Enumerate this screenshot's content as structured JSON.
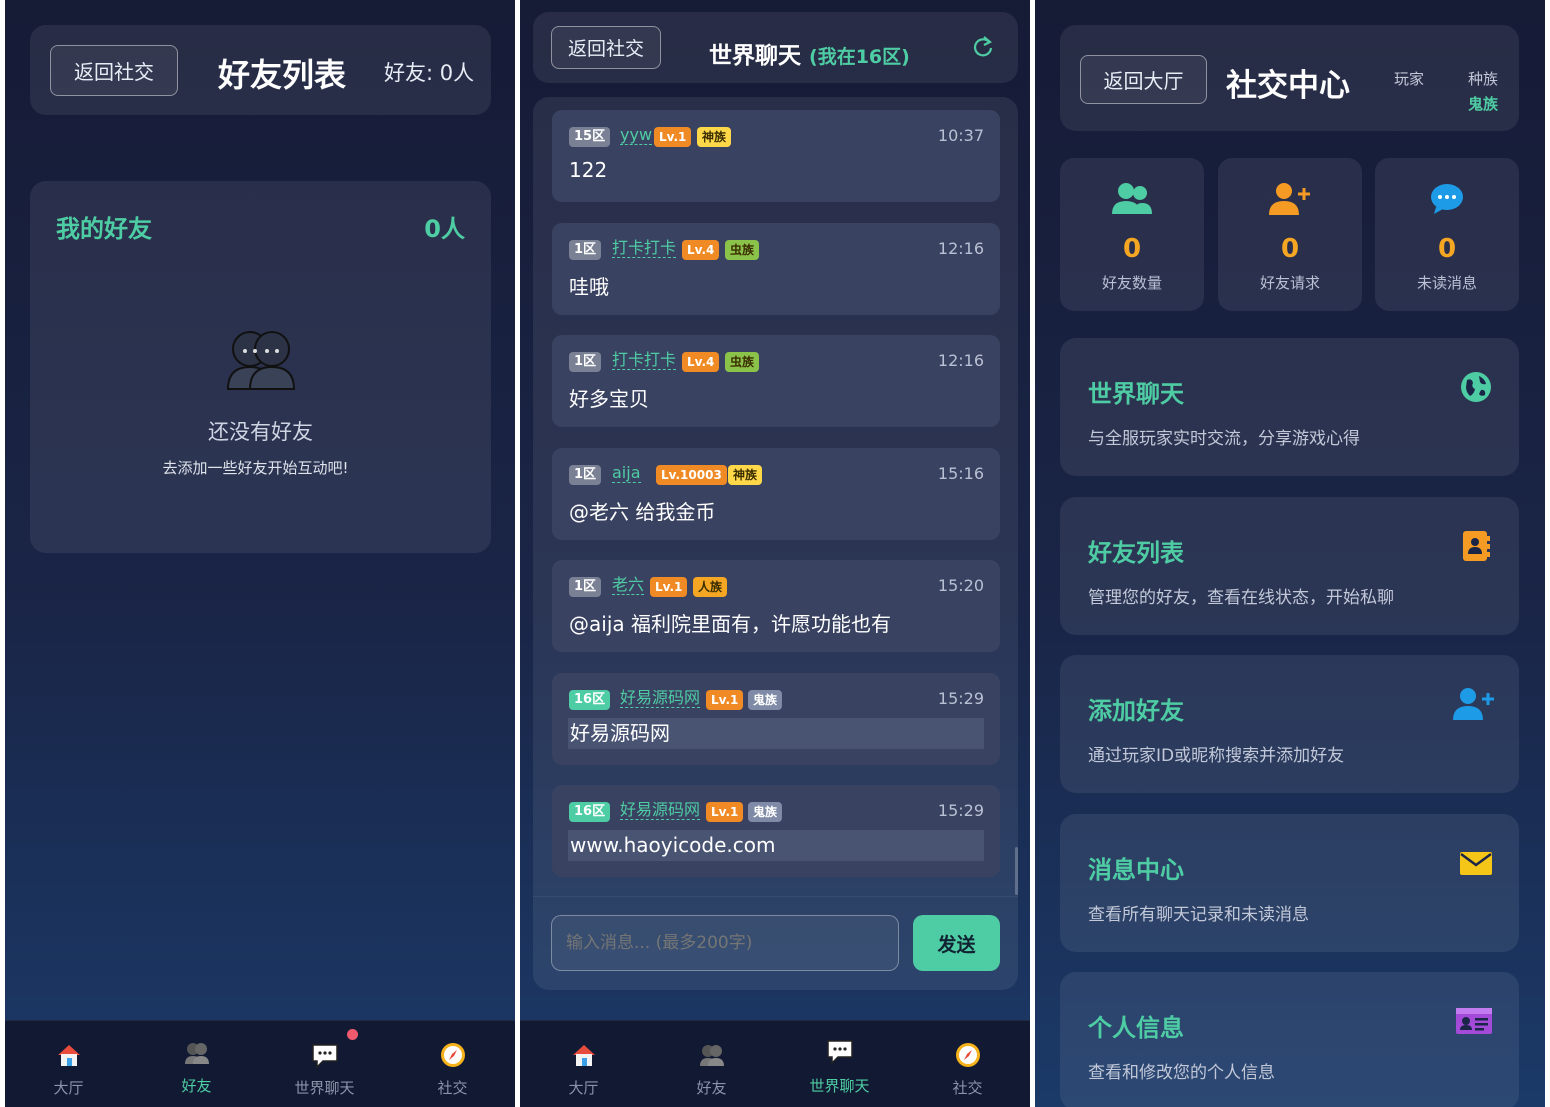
{
  "friends_screen": {
    "back_label": "返回社交",
    "title": "好友列表",
    "count_label": "好友: 0人",
    "section_title": "我的好友",
    "section_count": "0人",
    "empty_title": "还没有好友",
    "empty_hint": "去添加一些好友开始互动吧!"
  },
  "chat_screen": {
    "back_label": "返回社交",
    "title": "世界聊天",
    "zone_note": "(我在16区)",
    "refresh_icon": "refresh-icon",
    "messages": [
      {
        "zone": "15区",
        "name": "yyw",
        "level": "Lv.1",
        "race": "神族",
        "race_color": "#ffd84a",
        "time": "10:37",
        "text": "122",
        "mine": false
      },
      {
        "zone": "1区",
        "name": "打卡打卡",
        "level": "Lv.4",
        "race": "虫族",
        "race_color": "#8bc34a",
        "time": "12:16",
        "text": "哇哦",
        "mine": false
      },
      {
        "zone": "1区",
        "name": "打卡打卡",
        "level": "Lv.4",
        "race": "虫族",
        "race_color": "#8bc34a",
        "time": "12:16",
        "text": "好多宝贝",
        "mine": false
      },
      {
        "zone": "1区",
        "name": "aija",
        "level": "Lv.10003",
        "race": "神族",
        "race_color": "#ffd84a",
        "time": "15:16",
        "text": "@老六 给我金币",
        "mine": false
      },
      {
        "zone": "1区",
        "name": "老六",
        "level": "Lv.1",
        "race": "人族",
        "race_color": "#f5a623",
        "time": "15:20",
        "text": "@aija 福利院里面有，许愿功能也有",
        "mine": false
      },
      {
        "zone": "16区",
        "name": "好易源码网",
        "level": "Lv.1",
        "race": "鬼族",
        "race_color": "#7f8aa6",
        "time": "15:29",
        "text": "好易源码网",
        "mine": true
      },
      {
        "zone": "16区",
        "name": "好易源码网",
        "level": "Lv.1",
        "race": "鬼族",
        "race_color": "#7f8aa6",
        "time": "15:29",
        "text": "www.haoyicode.com",
        "mine": true
      }
    ],
    "input_placeholder": "输入消息... (最多200字)",
    "send_label": "发送"
  },
  "social_screen": {
    "back_label": "返回大厅",
    "title": "社交中心",
    "player_label": "玩家",
    "race_label": "种族",
    "race_value": "鬼族",
    "stats": [
      {
        "icon": "users-icon",
        "value": "0",
        "label": "好友数量"
      },
      {
        "icon": "user-plus-icon",
        "value": "0",
        "label": "好友请求"
      },
      {
        "icon": "chat-bubble-icon",
        "value": "0",
        "label": "未读消息"
      }
    ],
    "features": [
      {
        "icon": "globe-icon",
        "title": "世界聊天",
        "desc": "与全服玩家实时交流，分享游戏心得"
      },
      {
        "icon": "address-book-icon",
        "title": "好友列表",
        "desc": "管理您的好友，查看在线状态，开始私聊"
      },
      {
        "icon": "user-plus-icon",
        "title": "添加好友",
        "desc": "通过玩家ID或昵称搜索并添加好友"
      },
      {
        "icon": "envelope-icon",
        "title": "消息中心",
        "desc": "查看所有聊天记录和未读消息"
      },
      {
        "icon": "id-card-icon",
        "title": "个人信息",
        "desc": "查看和修改您的个人信息"
      }
    ]
  },
  "bottom_nav": {
    "items": [
      {
        "icon": "home-icon",
        "label": "大厅"
      },
      {
        "icon": "friends-icon",
        "label": "好友"
      },
      {
        "icon": "chat-icon",
        "label": "世界聊天"
      },
      {
        "icon": "compass-icon",
        "label": "社交"
      }
    ]
  },
  "colors": {
    "accent": "#4ecca3",
    "stat_number": "#f5a623",
    "level_badge": "#f08a24",
    "notification_dot": "#ef5a6f"
  }
}
